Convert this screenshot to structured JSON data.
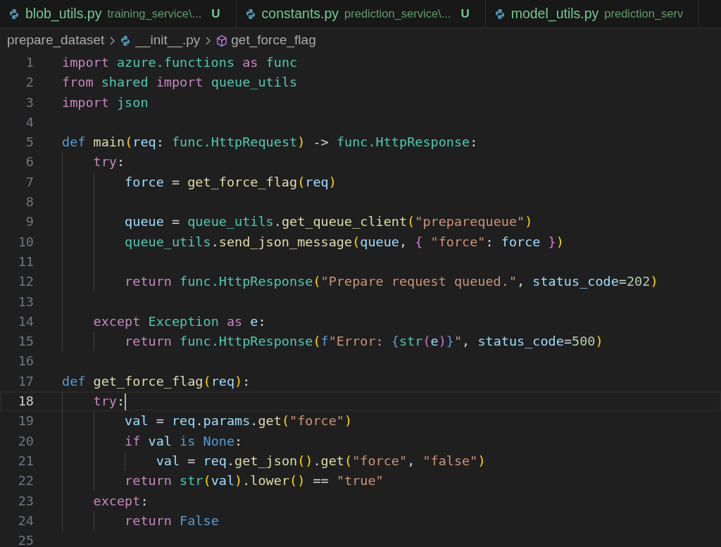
{
  "tabs": [
    {
      "filename": "blob_utils.py",
      "path": "training_service\\...",
      "status": "U"
    },
    {
      "filename": "constants.py",
      "path": "prediction_service\\...",
      "status": "U"
    },
    {
      "filename": "model_utils.py",
      "path": "prediction_serv"
    }
  ],
  "breadcrumb": [
    {
      "label": "prepare_dataset",
      "kind": "folder"
    },
    {
      "label": "__init__.py",
      "kind": "python"
    },
    {
      "label": "get_force_flag",
      "kind": "function"
    }
  ],
  "editor": {
    "lines": [
      {
        "number": "1",
        "current": false,
        "tokens": [
          {
            "text": "import",
            "kind": "keyword"
          },
          {
            "text": " azure.functions ",
            "kind": "type"
          },
          {
            "text": "as",
            "kind": "keyword"
          },
          {
            "text": " func",
            "kind": "type"
          }
        ]
      },
      {
        "number": "2",
        "current": false,
        "tokens": [
          {
            "text": "from",
            "kind": "keyword"
          },
          {
            "text": " shared ",
            "kind": "type"
          },
          {
            "text": "import",
            "kind": "keyword"
          },
          {
            "text": " queue_utils",
            "kind": "type"
          }
        ]
      },
      {
        "number": "3",
        "current": false,
        "tokens": [
          {
            "text": "import",
            "kind": "keyword"
          },
          {
            "text": " json",
            "kind": "type"
          }
        ]
      },
      {
        "number": "4",
        "current": false
      },
      {
        "number": "5",
        "current": false,
        "tokens": [
          {
            "text": "def ",
            "kind": "storage"
          },
          {
            "text": "main",
            "kind": "function"
          },
          {
            "text": "(",
            "kind": "bracket1"
          },
          {
            "text": "req",
            "kind": "variable"
          },
          {
            "text": ": ",
            "kind": "plain"
          },
          {
            "text": "func.HttpRequest",
            "kind": "type"
          },
          {
            "text": ")",
            "kind": "bracket1"
          },
          {
            "text": " -> ",
            "kind": "plain"
          },
          {
            "text": "func.HttpResponse",
            "kind": "type"
          },
          {
            "text": ":",
            "kind": "plain"
          }
        ]
      },
      {
        "number": "6",
        "current": false,
        "tokens": [
          {
            "text": "    try",
            "kind": "keyword"
          },
          {
            "text": ":",
            "kind": "plain"
          }
        ]
      },
      {
        "number": "7",
        "current": false,
        "tokens": [
          {
            "text": "        force",
            "kind": "variable"
          },
          {
            "text": " = ",
            "kind": "plain"
          },
          {
            "text": "get_force_flag",
            "kind": "function"
          },
          {
            "text": "(",
            "kind": "bracket1"
          },
          {
            "text": "req",
            "kind": "variable"
          },
          {
            "text": ")",
            "kind": "bracket1"
          }
        ]
      },
      {
        "number": "8",
        "current": false
      },
      {
        "number": "9",
        "current": false,
        "tokens": [
          {
            "text": "        queue",
            "kind": "variable"
          },
          {
            "text": " = ",
            "kind": "plain"
          },
          {
            "text": "queue_utils",
            "kind": "type"
          },
          {
            "text": ".",
            "kind": "plain"
          },
          {
            "text": "get_queue_client",
            "kind": "function"
          },
          {
            "text": "(",
            "kind": "bracket1"
          },
          {
            "text": "\"preparequeue\"",
            "kind": "string"
          },
          {
            "text": ")",
            "kind": "bracket1"
          }
        ]
      },
      {
        "number": "10",
        "current": false,
        "tokens": [
          {
            "text": "        queue_utils",
            "kind": "type"
          },
          {
            "text": ".",
            "kind": "plain"
          },
          {
            "text": "send_json_message",
            "kind": "function"
          },
          {
            "text": "(",
            "kind": "bracket1"
          },
          {
            "text": "queue",
            "kind": "variable"
          },
          {
            "text": ", ",
            "kind": "plain"
          },
          {
            "text": "{ ",
            "kind": "bracket2"
          },
          {
            "text": "\"force\"",
            "kind": "string"
          },
          {
            "text": ": ",
            "kind": "plain"
          },
          {
            "text": "force ",
            "kind": "variable"
          },
          {
            "text": "}",
            "kind": "bracket2"
          },
          {
            "text": ")",
            "kind": "bracket1"
          }
        ]
      },
      {
        "number": "11",
        "current": false
      },
      {
        "number": "12",
        "current": false,
        "tokens": [
          {
            "text": "        return ",
            "kind": "keyword"
          },
          {
            "text": "func.HttpResponse",
            "kind": "type"
          },
          {
            "text": "(",
            "kind": "bracket1"
          },
          {
            "text": "\"Prepare request queued.\"",
            "kind": "string"
          },
          {
            "text": ", ",
            "kind": "plain"
          },
          {
            "text": "status_code",
            "kind": "variable"
          },
          {
            "text": "=",
            "kind": "plain"
          },
          {
            "text": "202",
            "kind": "number"
          },
          {
            "text": ")",
            "kind": "bracket1"
          }
        ]
      },
      {
        "number": "13",
        "current": false
      },
      {
        "number": "14",
        "current": false,
        "tokens": [
          {
            "text": "    except ",
            "kind": "keyword"
          },
          {
            "text": "Exception ",
            "kind": "type"
          },
          {
            "text": "as ",
            "kind": "keyword"
          },
          {
            "text": "e",
            "kind": "variable"
          },
          {
            "text": ":",
            "kind": "plain"
          }
        ]
      },
      {
        "number": "15",
        "current": false,
        "tokens": [
          {
            "text": "        return ",
            "kind": "keyword"
          },
          {
            "text": "func.HttpResponse",
            "kind": "type"
          },
          {
            "text": "(",
            "kind": "bracket1"
          },
          {
            "text": "f",
            "kind": "storage"
          },
          {
            "text": "\"Error: ",
            "kind": "string"
          },
          {
            "text": "{",
            "kind": "storage"
          },
          {
            "text": "str",
            "kind": "type"
          },
          {
            "text": "(",
            "kind": "bracket2"
          },
          {
            "text": "e",
            "kind": "variable"
          },
          {
            "text": ")",
            "kind": "bracket2"
          },
          {
            "text": "}",
            "kind": "storage"
          },
          {
            "text": "\"",
            "kind": "string"
          },
          {
            "text": ", ",
            "kind": "plain"
          },
          {
            "text": "status_code",
            "kind": "variable"
          },
          {
            "text": "=",
            "kind": "plain"
          },
          {
            "text": "500",
            "kind": "number"
          },
          {
            "text": ")",
            "kind": "bracket1"
          }
        ]
      },
      {
        "number": "16",
        "current": false
      },
      {
        "number": "17",
        "current": false,
        "tokens": [
          {
            "text": "def ",
            "kind": "storage"
          },
          {
            "text": "get_force_flag",
            "kind": "function"
          },
          {
            "text": "(",
            "kind": "bracket1"
          },
          {
            "text": "req",
            "kind": "variable"
          },
          {
            "text": ")",
            "kind": "bracket1"
          },
          {
            "text": ":",
            "kind": "plain"
          }
        ]
      },
      {
        "number": "18",
        "current": true,
        "tokens": [
          {
            "text": "    try",
            "kind": "keyword"
          },
          {
            "text": ":",
            "kind": "plain"
          }
        ]
      },
      {
        "number": "19",
        "current": false,
        "tokens": [
          {
            "text": "        val",
            "kind": "variable"
          },
          {
            "text": " = ",
            "kind": "plain"
          },
          {
            "text": "req",
            "kind": "variable"
          },
          {
            "text": ".",
            "kind": "plain"
          },
          {
            "text": "params",
            "kind": "variable"
          },
          {
            "text": ".",
            "kind": "plain"
          },
          {
            "text": "get",
            "kind": "function"
          },
          {
            "text": "(",
            "kind": "bracket1"
          },
          {
            "text": "\"force\"",
            "kind": "string"
          },
          {
            "text": ")",
            "kind": "bracket1"
          }
        ]
      },
      {
        "number": "20",
        "current": false,
        "tokens": [
          {
            "text": "        if ",
            "kind": "keyword"
          },
          {
            "text": "val ",
            "kind": "variable"
          },
          {
            "text": "is None",
            "kind": "storage"
          },
          {
            "text": ":",
            "kind": "plain"
          }
        ]
      },
      {
        "number": "21",
        "current": false,
        "tokens": [
          {
            "text": "            val",
            "kind": "variable"
          },
          {
            "text": " = ",
            "kind": "plain"
          },
          {
            "text": "req",
            "kind": "variable"
          },
          {
            "text": ".",
            "kind": "plain"
          },
          {
            "text": "get_json",
            "kind": "function"
          },
          {
            "text": "()",
            "kind": "bracket1"
          },
          {
            "text": ".",
            "kind": "plain"
          },
          {
            "text": "get",
            "kind": "function"
          },
          {
            "text": "(",
            "kind": "bracket1"
          },
          {
            "text": "\"force\"",
            "kind": "string"
          },
          {
            "text": ", ",
            "kind": "plain"
          },
          {
            "text": "\"false\"",
            "kind": "string"
          },
          {
            "text": ")",
            "kind": "bracket1"
          }
        ]
      },
      {
        "number": "22",
        "current": false,
        "tokens": [
          {
            "text": "        return ",
            "kind": "keyword"
          },
          {
            "text": "str",
            "kind": "type"
          },
          {
            "text": "(",
            "kind": "bracket1"
          },
          {
            "text": "val",
            "kind": "variable"
          },
          {
            "text": ")",
            "kind": "bracket1"
          },
          {
            "text": ".",
            "kind": "plain"
          },
          {
            "text": "lower",
            "kind": "function"
          },
          {
            "text": "()",
            "kind": "bracket1"
          },
          {
            "text": " == ",
            "kind": "plain"
          },
          {
            "text": "\"true\"",
            "kind": "string"
          }
        ]
      },
      {
        "number": "23",
        "current": false,
        "tokens": [
          {
            "text": "    except",
            "kind": "keyword"
          },
          {
            "text": ":",
            "kind": "plain"
          }
        ]
      },
      {
        "number": "24",
        "current": false,
        "tokens": [
          {
            "text": "        return ",
            "kind": "keyword"
          },
          {
            "text": "False",
            "kind": "storage"
          }
        ]
      },
      {
        "number": "25",
        "current": false
      }
    ]
  }
}
